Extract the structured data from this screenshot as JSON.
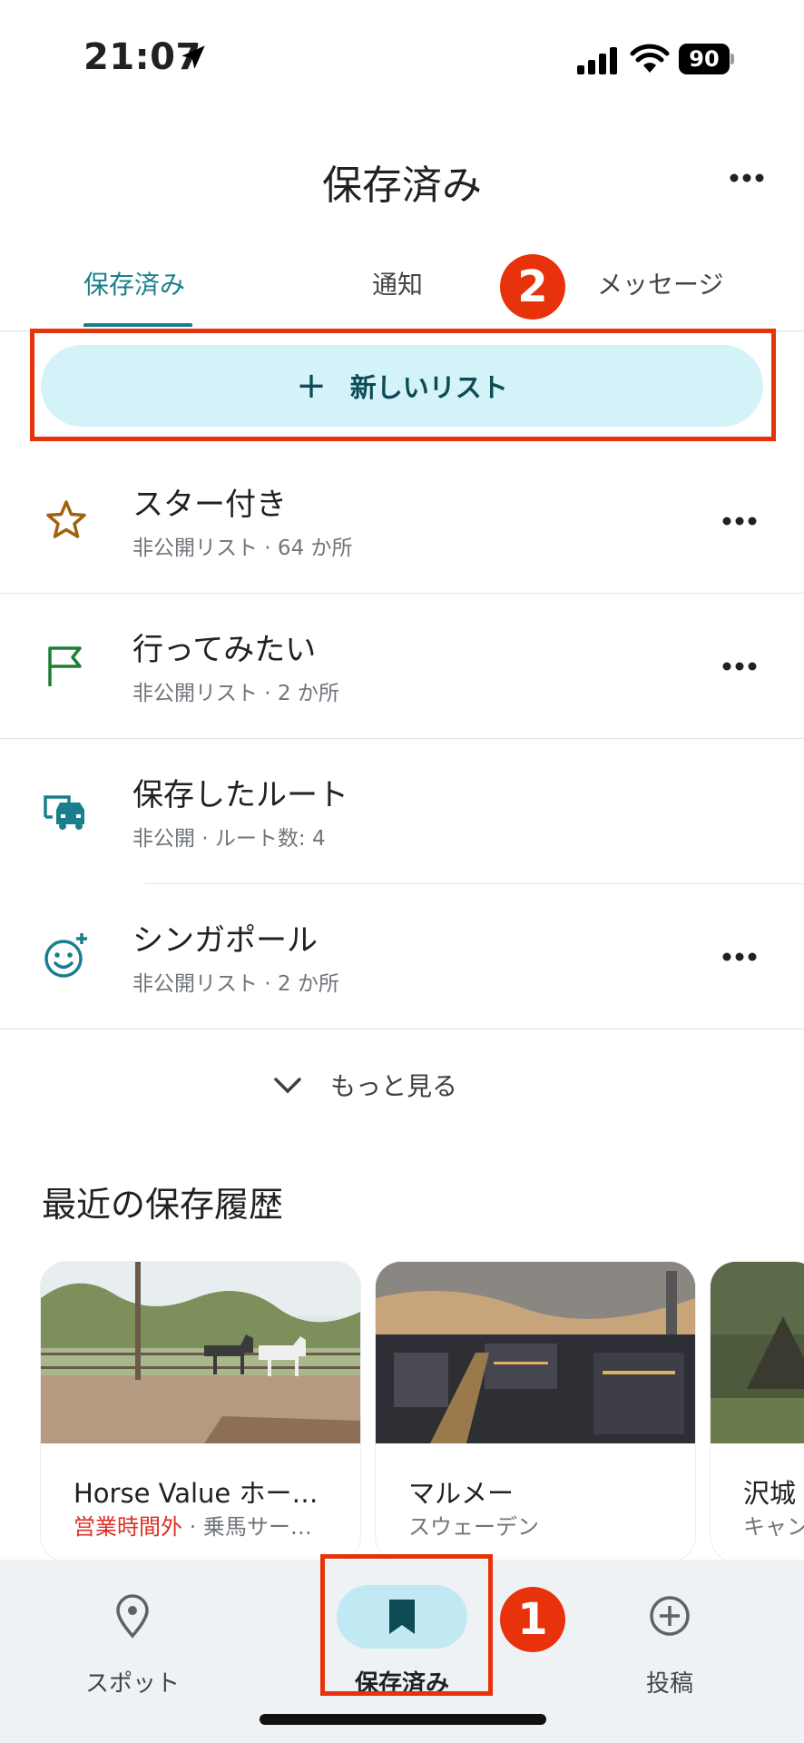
{
  "status_bar": {
    "time": "21:07",
    "battery": "90"
  },
  "header": {
    "title": "保存済み"
  },
  "tabs": [
    {
      "label": "保存済み",
      "active": true
    },
    {
      "label": "通知",
      "active": false
    },
    {
      "label": "メッセージ",
      "active": false
    }
  ],
  "markers": {
    "one": "1",
    "two": "2"
  },
  "new_list": {
    "label": "新しいリスト",
    "plus": "+"
  },
  "lists": [
    {
      "title": "スター付き",
      "subtitle": "非公開リスト · 64 か所",
      "icon": "star-icon",
      "color": "#a0620a"
    },
    {
      "title": "行ってみたい",
      "subtitle": "非公開リスト · 2 か所",
      "icon": "flag-icon",
      "color": "#1e7e34"
    },
    {
      "title": "保存したルート",
      "subtitle": "非公開 · ルート数: 4",
      "icon": "car-icon",
      "color": "#1a7f8c"
    },
    {
      "title": "シンガポール",
      "subtitle": "非公開リスト · 2 か所",
      "icon": "smiley-icon",
      "color": "#1a7f8c"
    }
  ],
  "show_more": {
    "label": "もっと見る"
  },
  "recent": {
    "title": "最近の保存履歴",
    "cards": [
      {
        "title": "Horse Value ホー…",
        "status": "営業時間外",
        "subtitle": " · 乗馬サー…"
      },
      {
        "title": "マルメー",
        "status": "",
        "subtitle": "スウェーデン"
      },
      {
        "title": "沢城",
        "status": "",
        "subtitle": "キャン"
      }
    ]
  },
  "bottom_nav": [
    {
      "label": "スポット",
      "icon": "location-pin-icon"
    },
    {
      "label": "保存済み",
      "icon": "bookmark-icon",
      "active": true
    },
    {
      "label": "投稿",
      "icon": "add-circle-icon"
    }
  ],
  "colors": {
    "accent": "#1a7f8c",
    "marker": "#e8320b",
    "button_bg": "#d3f3f9"
  }
}
